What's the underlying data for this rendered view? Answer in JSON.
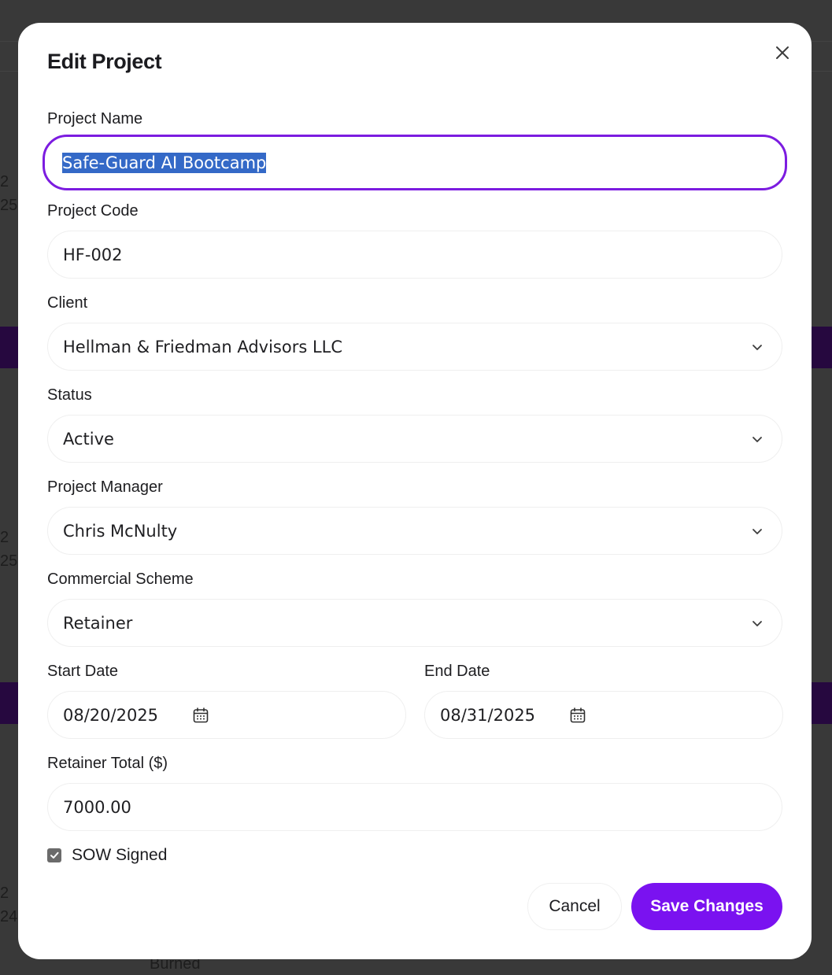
{
  "background": {
    "fragments": [
      "2",
      "25",
      "2",
      "25",
      "2",
      "24"
    ],
    "burned_text": "Burned"
  },
  "modal": {
    "title": "Edit Project",
    "close_icon": "close-icon"
  },
  "form": {
    "project_name": {
      "label": "Project Name",
      "value": "Safe-Guard AI Bootcamp",
      "selected": true
    },
    "project_code": {
      "label": "Project Code",
      "value": "HF-002"
    },
    "client": {
      "label": "Client",
      "value": "Hellman & Friedman Advisors LLC"
    },
    "status": {
      "label": "Status",
      "value": "Active"
    },
    "project_manager": {
      "label": "Project Manager",
      "value": "Chris McNulty"
    },
    "commercial_scheme": {
      "label": "Commercial Scheme",
      "value": "Retainer"
    },
    "start_date": {
      "label": "Start Date",
      "value": "08/20/2025"
    },
    "end_date": {
      "label": "End Date",
      "value": "08/31/2025"
    },
    "retainer_total": {
      "label": "Retainer Total ($)",
      "value": "7000.00"
    },
    "sow_signed": {
      "label": "SOW Signed",
      "checked": true
    }
  },
  "actions": {
    "cancel_label": "Cancel",
    "save_label": "Save Changes"
  },
  "colors": {
    "accent": "#7a12f0",
    "focus_ring": "#7c1ce0",
    "text_selection": "#3469c7",
    "overlay": "#393939"
  }
}
